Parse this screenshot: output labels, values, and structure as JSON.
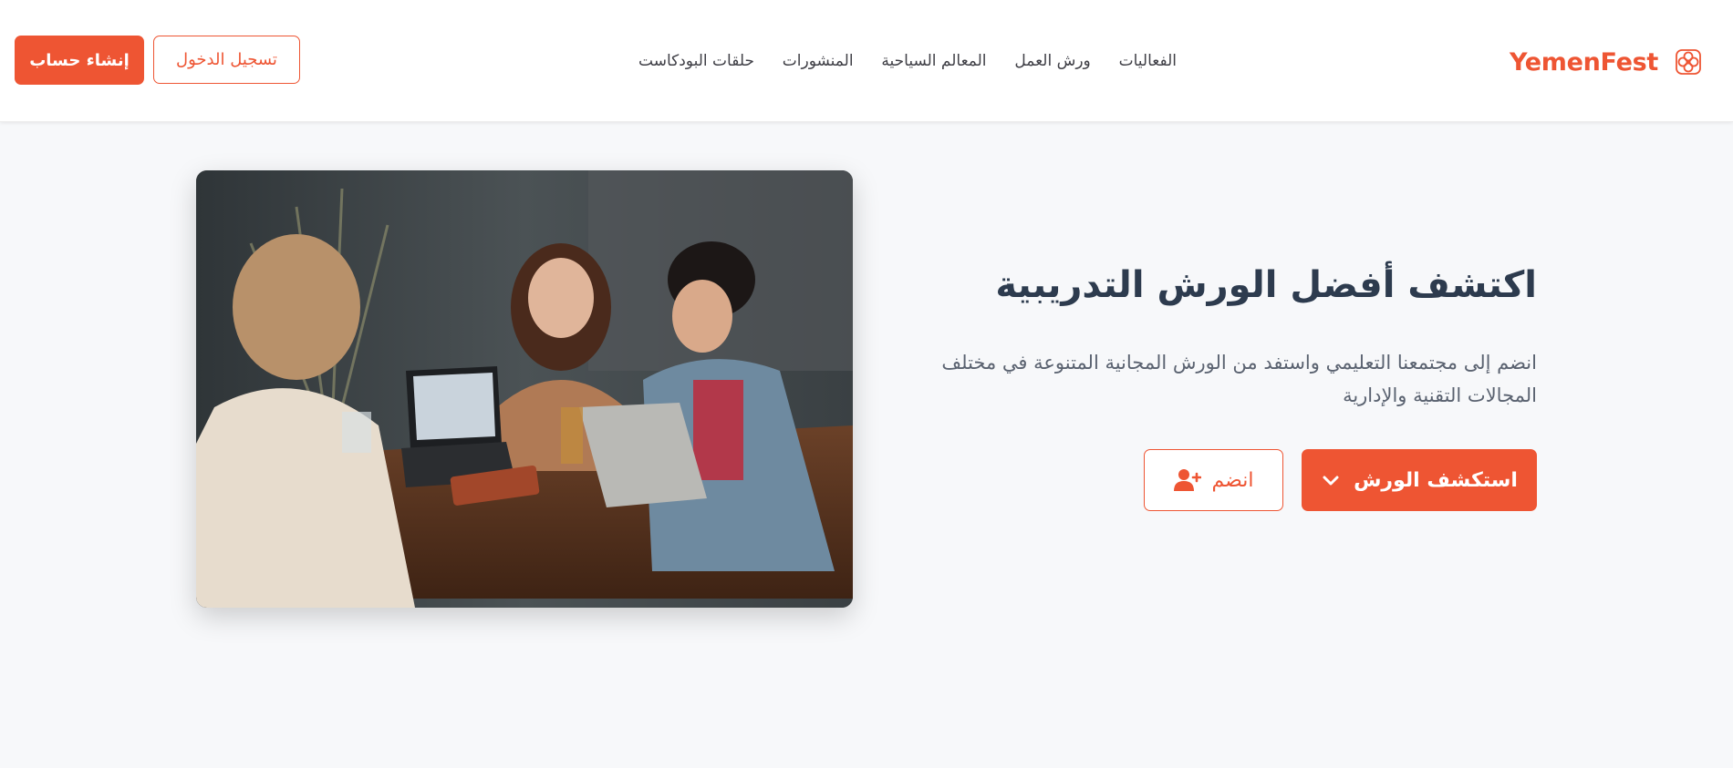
{
  "brand": {
    "name": "YemenFest",
    "accent_color": "#ee5533",
    "logo_icon": "flower-logo-icon"
  },
  "nav": {
    "items": [
      {
        "label": "الفعاليات"
      },
      {
        "label": "ورش العمل"
      },
      {
        "label": "المعالم السياحية"
      },
      {
        "label": "المنشورات"
      },
      {
        "label": "حلقات البودكاست"
      }
    ]
  },
  "auth": {
    "login_label": "تسجيل الدخول",
    "signup_label": "إنشاء حساب"
  },
  "hero": {
    "title": "اكتشف أفضل الورش التدريبية",
    "description": "انضم إلى مجتمعنا التعليمي واستفد من الورش المجانية المتنوعة في مختلف المجالات التقنية والإدارية",
    "explore_label": "استكشف الورش",
    "explore_icon": "chevron-down-icon",
    "join_label": "انضم",
    "join_icon": "user-plus-icon",
    "image_subject": "people-working-on-laptops-photo"
  }
}
